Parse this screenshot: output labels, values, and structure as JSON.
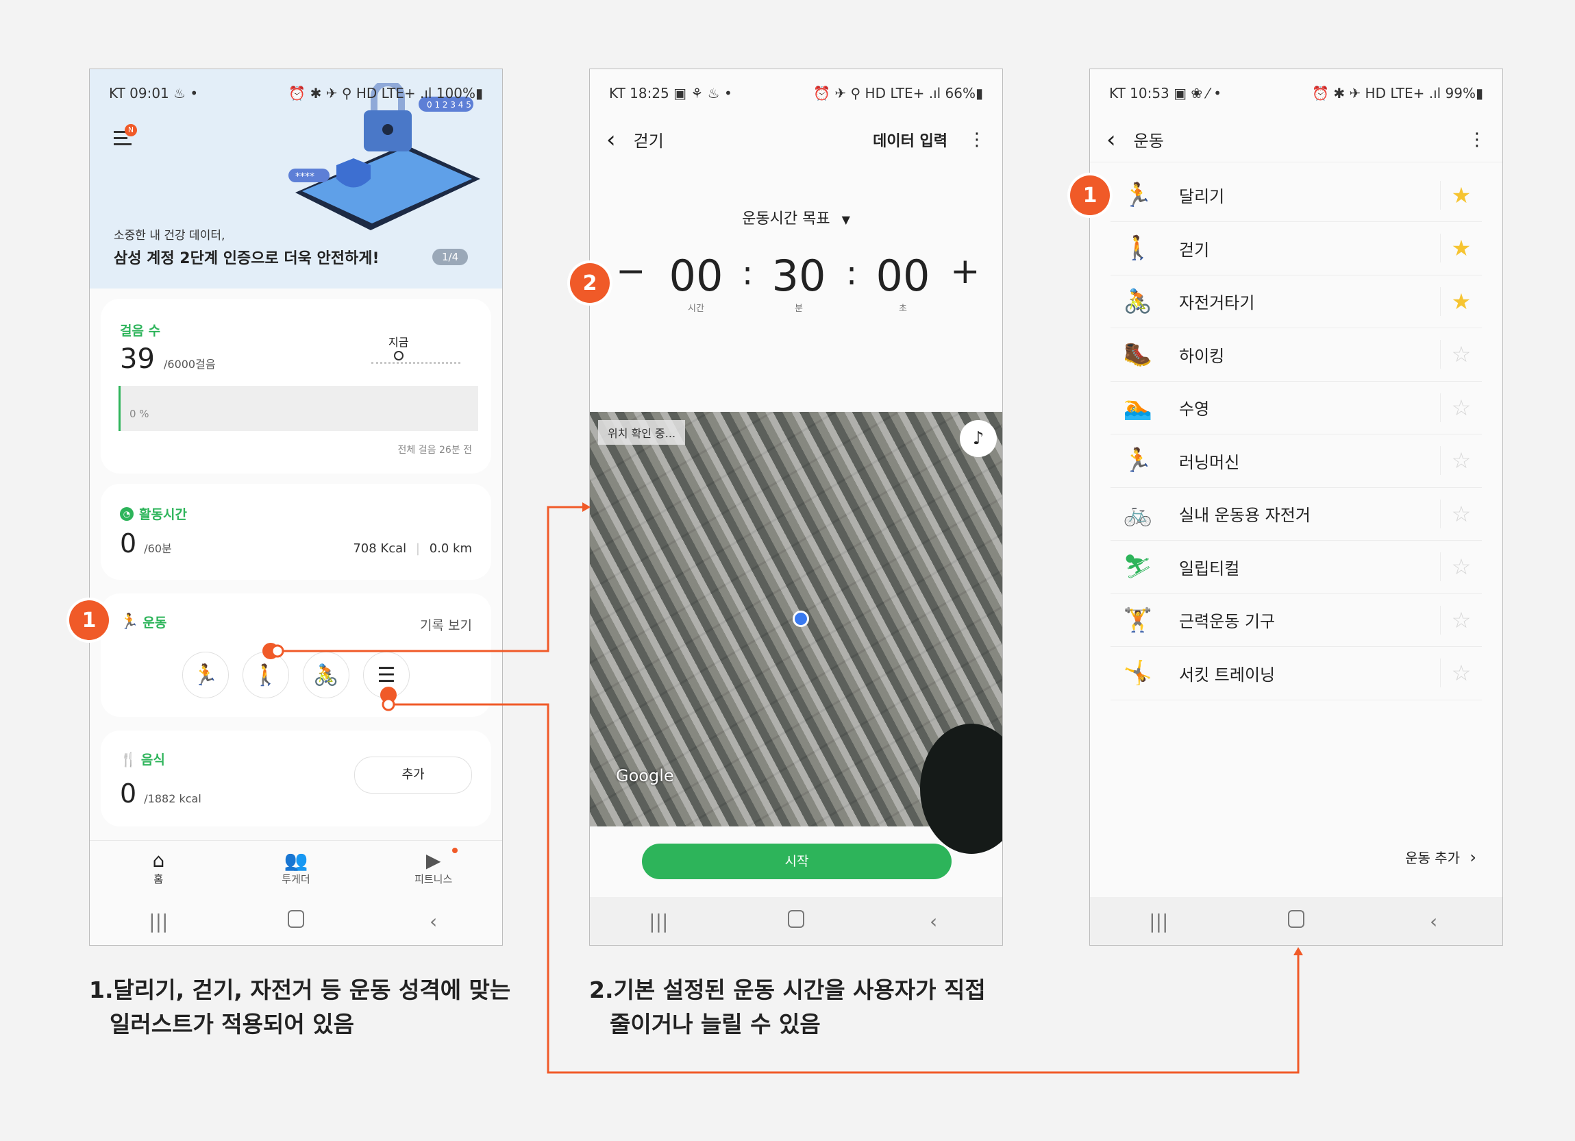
{
  "phone1": {
    "status_left": "KT 09:01 ♨ •",
    "status_right": "⏰ ✱ ✈ ⚲ HD LTE+ .ıl 100%▮",
    "menu_badge": "N",
    "banner": {
      "line1": "소중한 내 건강 데이터,",
      "line2": "삼성 계정 2단계 인증으로 더욱 안전하게!",
      "counter": "1/4",
      "pill_text": "0 1 2 3 4 5",
      "stars_text": "****"
    },
    "steps": {
      "label": "걸음 수",
      "value": "39",
      "goal": "/6000걸음",
      "now_label": "지금",
      "percent": "0 %",
      "footer": "전체 걸음 26분 전",
      "progress": 0.0065
    },
    "activity": {
      "label": "활동시간",
      "value": "0",
      "goal": "/60분",
      "kcal": "708 Kcal",
      "km": "0.0 km"
    },
    "exercise": {
      "label": "운동",
      "link": "기록 보기"
    },
    "food": {
      "label": "음식",
      "value": "0",
      "goal": "/1882 kcal",
      "add": "추가"
    },
    "tabs": [
      {
        "label": "홈"
      },
      {
        "label": "투게더"
      },
      {
        "label": "피트니스"
      }
    ]
  },
  "phone2": {
    "status_left": "KT 18:25 ▣ ⚘ ♨ •",
    "status_right": "⏰ ✈ ⚲ HD LTE+ .ıl 66%▮",
    "back_title": "걷기",
    "action": "데이터 입력",
    "goal_label": "운동시간 목표",
    "minus": "−",
    "plus": "+",
    "hours": "00",
    "minutes": "30",
    "seconds": "00",
    "hours_unit": "시간",
    "minutes_unit": "분",
    "seconds_unit": "초",
    "map_status": "위치 확인 중...",
    "map_brand": "Google",
    "start": "시작"
  },
  "phone3": {
    "status_left": "KT 10:53 ▣ ❀ ⁄ •",
    "status_right": "⏰ ✱ ✈ HD LTE+ .ıl 99%▮",
    "title": "운동",
    "items": [
      {
        "label": "달리기",
        "icon": "running-icon",
        "glyph": "🏃",
        "fav": true
      },
      {
        "label": "걷기",
        "icon": "walking-icon",
        "glyph": "🚶",
        "fav": true
      },
      {
        "label": "자전거타기",
        "icon": "cycling-icon",
        "glyph": "🚴",
        "fav": true
      },
      {
        "label": "하이킹",
        "icon": "hiking-icon",
        "glyph": "🥾",
        "fav": false
      },
      {
        "label": "수영",
        "icon": "swimming-icon",
        "glyph": "🏊",
        "fav": false
      },
      {
        "label": "러닝머신",
        "icon": "treadmill-icon",
        "glyph": "🏃",
        "fav": false
      },
      {
        "label": "실내 운동용 자전거",
        "icon": "indoor-bike-icon",
        "glyph": "🚲",
        "fav": false
      },
      {
        "label": "일립티컬",
        "icon": "elliptical-icon",
        "glyph": "⛷",
        "fav": false
      },
      {
        "label": "근력운동 기구",
        "icon": "weight-machine-icon",
        "glyph": "🏋",
        "fav": false
      },
      {
        "label": "서킷 트레이닝",
        "icon": "circuit-training-icon",
        "glyph": "🤸",
        "fav": false
      }
    ],
    "add_exercise": "운동 추가"
  },
  "badges": {
    "one": "1",
    "two": "2"
  },
  "captions": {
    "c1_line1": "1.달리기, 걷기, 자전거 등 운동 성격에 맞는",
    "c1_line2": "일러스트가 적용되어 있음",
    "c2_line1": "2.기본 설정된 운동 시간을 사용자가 직접",
    "c2_line2": "줄이거나 늘릴 수 있음"
  },
  "colors": {
    "accent_green": "#2db45a",
    "annotation_orange": "#f05a28",
    "star_yellow": "#f6c431",
    "banner_bg": "#e3eef8"
  }
}
